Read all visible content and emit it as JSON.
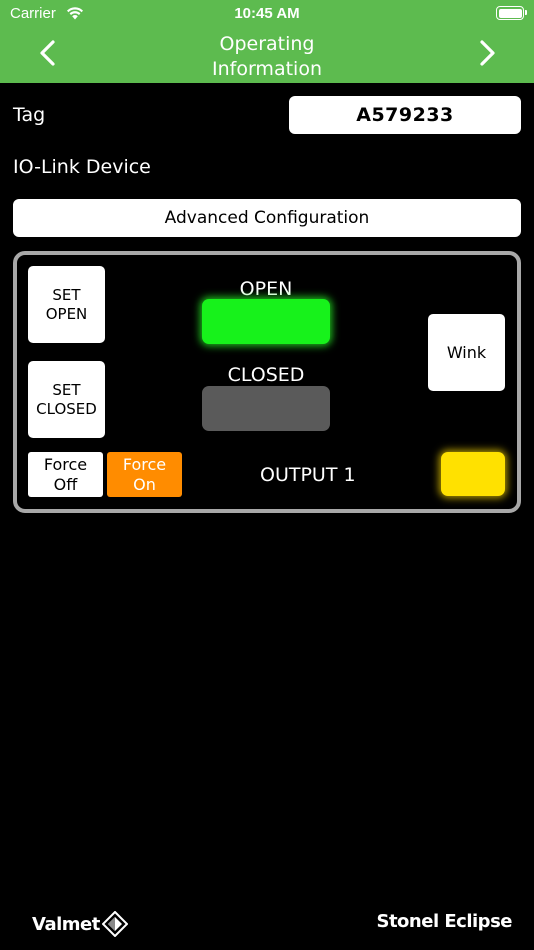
{
  "status_bar": {
    "carrier": "Carrier",
    "time": "10:45 AM"
  },
  "nav": {
    "title_line1": "Operating",
    "title_line2": "Information",
    "back_icon": "chevron-left-icon",
    "forward_icon": "chevron-right-icon"
  },
  "tag": {
    "label": "Tag",
    "value": "A579233"
  },
  "device": {
    "label": "IO-Link Device"
  },
  "advanced_button": {
    "label": "Advanced Configuration"
  },
  "panel": {
    "set_open": {
      "line1": "SET",
      "line2": "OPEN"
    },
    "set_closed": {
      "line1": "SET",
      "line2": "CLOSED"
    },
    "wink": "Wink",
    "open_label": "OPEN",
    "closed_label": "CLOSED",
    "force_off": {
      "line1": "Force",
      "line2": "Off"
    },
    "force_on": {
      "line1": "Force",
      "line2": "On"
    },
    "output_label": "OUTPUT 1",
    "open_active": true,
    "closed_active": false,
    "output_active": true
  },
  "colors": {
    "header_green": "#5dbb4f",
    "open_lamp": "#17f21b",
    "closed_lamp": "#5a5a5a",
    "force_on": "#ff8c00",
    "output_lamp": "#ffe100",
    "panel_border": "#a8a8a8"
  },
  "footer": {
    "left_brand": "Valmet",
    "right_brand": "Stonel Eclipse"
  }
}
